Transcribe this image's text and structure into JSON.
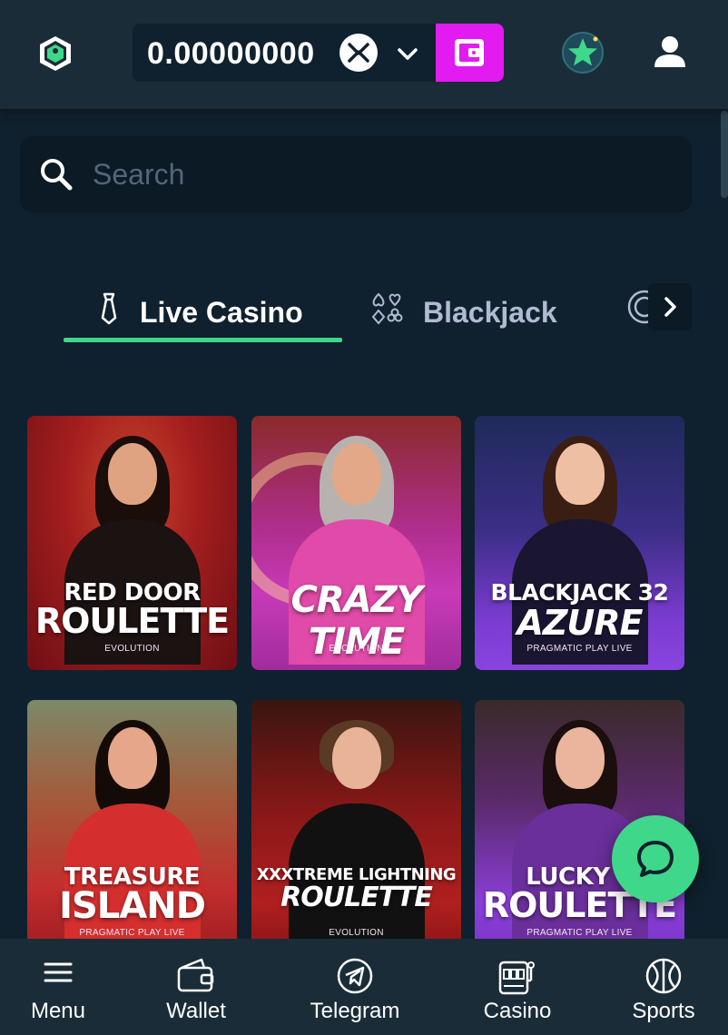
{
  "header": {
    "balance": "0.00000000",
    "currency_icon": "xrp-icon",
    "accent_color": "#e21bf0"
  },
  "search": {
    "placeholder": "Search"
  },
  "tabs": [
    {
      "label": "Live Casino",
      "icon": "necktie-icon",
      "active": true
    },
    {
      "label": "Blackjack",
      "icon": "card-suits-icon",
      "active": false
    }
  ],
  "games": [
    {
      "title_line1": "RED DOOR",
      "title_line2": "ROULETTE",
      "provider": "EVOLUTION",
      "theme": "red"
    },
    {
      "title_line1": "",
      "title_line2": "CRAZY TIME",
      "provider": "EVOLUTION",
      "theme": "magenta"
    },
    {
      "title_line1": "BLACKJACK 32",
      "title_line2": "AZURE",
      "provider": "PRAGMATIC PLAY LIVE",
      "theme": "purple"
    },
    {
      "title_line1": "TREASURE",
      "title_line2": "ISLAND",
      "provider": "PRAGMATIC PLAY LIVE",
      "theme": "red"
    },
    {
      "title_line1": "XXXTREME LIGHTNING",
      "title_line2": "ROULETTE",
      "provider": "EVOLUTION",
      "theme": "dark-red"
    },
    {
      "title_line1": "LUCKY 6",
      "title_line2": "ROULETTE",
      "provider": "PRAGMATIC PLAY LIVE",
      "theme": "purple"
    }
  ],
  "bottom_nav": [
    {
      "label": "Menu",
      "icon": "menu-icon"
    },
    {
      "label": "Wallet",
      "icon": "wallet-icon"
    },
    {
      "label": "Telegram",
      "icon": "telegram-icon"
    },
    {
      "label": "Casino",
      "icon": "slot-machine-icon"
    },
    {
      "label": "Sports",
      "icon": "basketball-icon"
    }
  ],
  "colors": {
    "background": "#0f212e",
    "header": "#1a2c38",
    "active_tab_underline": "#3fd78a",
    "chat_button": "#3fd78a"
  }
}
